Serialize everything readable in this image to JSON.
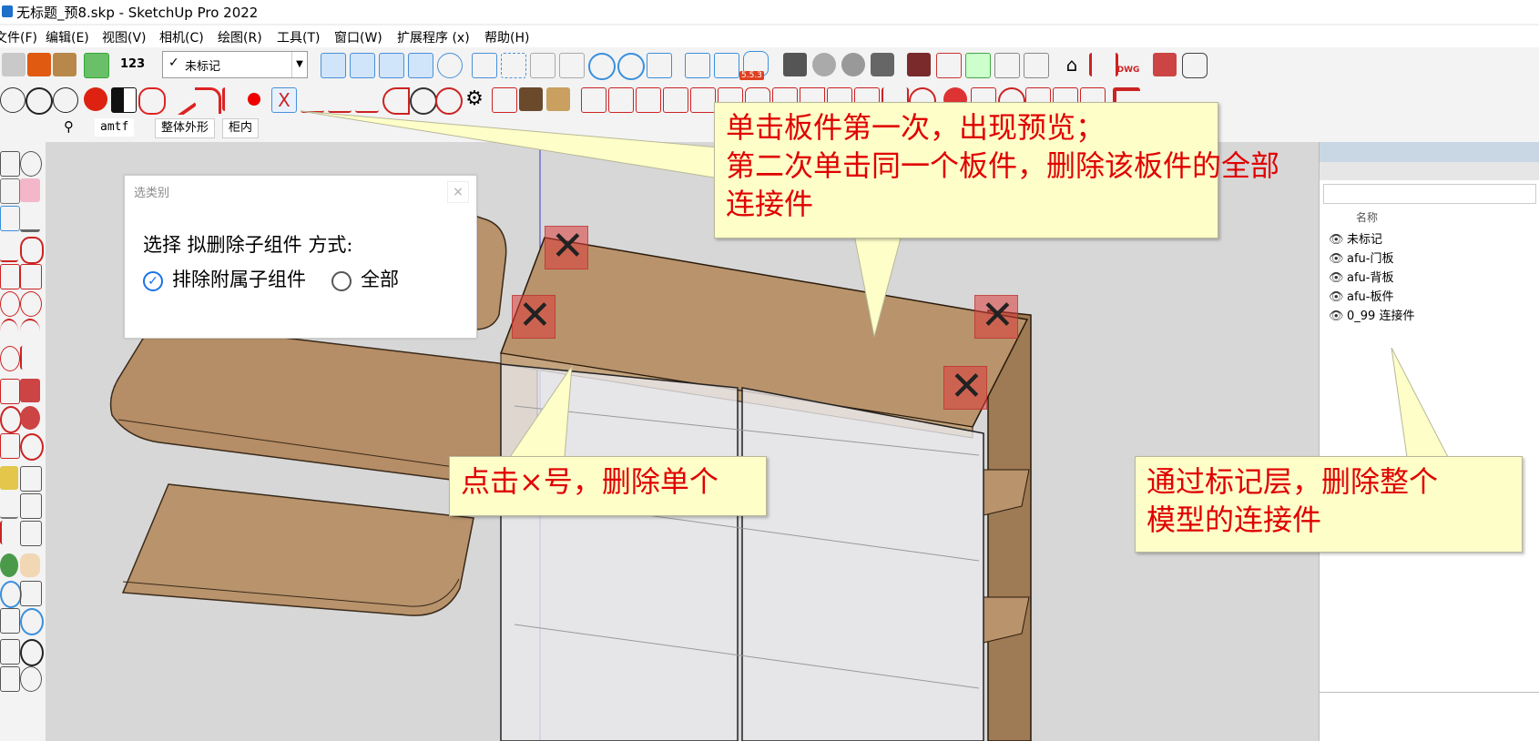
{
  "window": {
    "title": "无标题_预8.skp - SketchUp Pro 2022"
  },
  "menu": [
    "文件(F)",
    "编辑(E)",
    "视图(V)",
    "相机(C)",
    "绘图(R)",
    "工具(T)",
    "窗口(W)",
    "扩展程序 (x)",
    "帮助(H)"
  ],
  "toolbar": {
    "tag_combo_value": "未标记",
    "badge_123": "123",
    "badge_version": "5.5.3",
    "badge_dwg": "DWG"
  },
  "searchbar": {
    "query": "amtf",
    "tabs": [
      "整体外形",
      "柜内"
    ]
  },
  "dialog": {
    "title": "选类别",
    "close": "×",
    "prompt": "选择 拟删除子组件 方式:",
    "option_exclude": "排除附属子组件",
    "option_all": "全部",
    "selected": "option_exclude"
  },
  "tags_panel": {
    "header_partial": "名称",
    "items": [
      "未标记",
      "afu-门板",
      "afu-背板",
      "afu-板件",
      "0_99 连接件"
    ]
  },
  "callouts": {
    "top": [
      "单击板件第一次，出现预览；",
      "第二次单击同一个板件，删除该板件的全部",
      "连接件"
    ],
    "left": "点击×号，删除单个",
    "right": [
      "通过标记层，删除整个",
      "模型的连接件"
    ]
  },
  "colors": {
    "callout_bg": "#fefec8",
    "callout_text": "#e00000",
    "wood": "#b8936c",
    "xmark": "#dc3c3c",
    "accent_blue": "#1a73e8"
  }
}
